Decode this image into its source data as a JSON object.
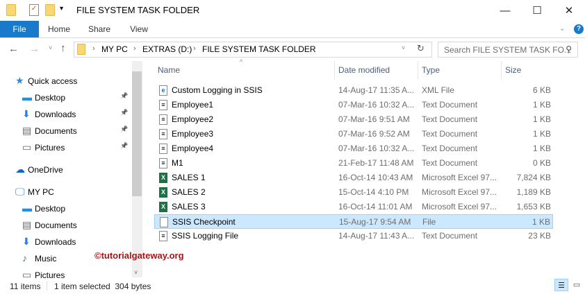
{
  "window": {
    "title": "FILE SYSTEM TASK FOLDER"
  },
  "ribbon": {
    "tabs": [
      "File",
      "Home",
      "Share",
      "View"
    ],
    "help": "?"
  },
  "address": {
    "crumbs": [
      "MY PC",
      "EXTRAS (D:)",
      "FILE SYSTEM TASK FOLDER"
    ],
    "search_placeholder": "Search FILE SYSTEM TASK FO..."
  },
  "nav": {
    "items": [
      {
        "label": "Quick access",
        "icon": "star-icon",
        "pinned": false
      },
      {
        "label": "Desktop",
        "icon": "desktop-icon",
        "pinned": true
      },
      {
        "label": "Downloads",
        "icon": "download-icon",
        "pinned": true
      },
      {
        "label": "Documents",
        "icon": "documents-icon",
        "pinned": true
      },
      {
        "label": "Pictures",
        "icon": "pictures-icon",
        "pinned": true
      },
      {
        "label": "OneDrive",
        "icon": "cloud-icon",
        "pinned": false
      },
      {
        "label": "MY PC",
        "icon": "computer-icon",
        "pinned": false
      },
      {
        "label": "Desktop",
        "icon": "desktop-icon",
        "pinned": false
      },
      {
        "label": "Documents",
        "icon": "documents-icon",
        "pinned": false
      },
      {
        "label": "Downloads",
        "icon": "download-icon",
        "pinned": false
      },
      {
        "label": "Music",
        "icon": "music-icon",
        "pinned": false
      },
      {
        "label": "Pictures",
        "icon": "pictures-icon",
        "pinned": false
      }
    ]
  },
  "columns": [
    "Name",
    "Date modified",
    "Type",
    "Size"
  ],
  "files": [
    {
      "name": "Custom Logging in SSIS",
      "date": "14-Aug-17 11:35 A...",
      "type": "XML File",
      "size": "6 KB",
      "icon": "ie"
    },
    {
      "name": "Employee1",
      "date": "07-Mar-16 10:32 A...",
      "type": "Text Document",
      "size": "1 KB",
      "icon": "txt"
    },
    {
      "name": "Employee2",
      "date": "07-Mar-16 9:51 AM",
      "type": "Text Document",
      "size": "1 KB",
      "icon": "txt"
    },
    {
      "name": "Employee3",
      "date": "07-Mar-16 9:52 AM",
      "type": "Text Document",
      "size": "1 KB",
      "icon": "txt"
    },
    {
      "name": "Employee4",
      "date": "07-Mar-16 10:32 A...",
      "type": "Text Document",
      "size": "1 KB",
      "icon": "txt"
    },
    {
      "name": "M1",
      "date": "21-Feb-17 11:48 AM",
      "type": "Text Document",
      "size": "0 KB",
      "icon": "txt"
    },
    {
      "name": "SALES 1",
      "date": "16-Oct-14 10:43 AM",
      "type": "Microsoft Excel 97...",
      "size": "7,824 KB",
      "icon": "xl"
    },
    {
      "name": "SALES 2",
      "date": "15-Oct-14 4:10 PM",
      "type": "Microsoft Excel 97...",
      "size": "1,189 KB",
      "icon": "xl"
    },
    {
      "name": "SALES 3",
      "date": "16-Oct-14 11:01 AM",
      "type": "Microsoft Excel 97...",
      "size": "1,653 KB",
      "icon": "xl"
    },
    {
      "name": "SSIS Checkpoint",
      "date": "15-Aug-17 9:54 AM",
      "type": "File",
      "size": "1 KB",
      "icon": "blank",
      "selected": true
    },
    {
      "name": "SSIS Logging File",
      "date": "14-Aug-17 11:43 A...",
      "type": "Text Document",
      "size": "23 KB",
      "icon": "txt"
    }
  ],
  "status": {
    "count": "11 items",
    "selection": "1 item selected  304 bytes"
  },
  "watermark": "©tutorialgateway.org"
}
